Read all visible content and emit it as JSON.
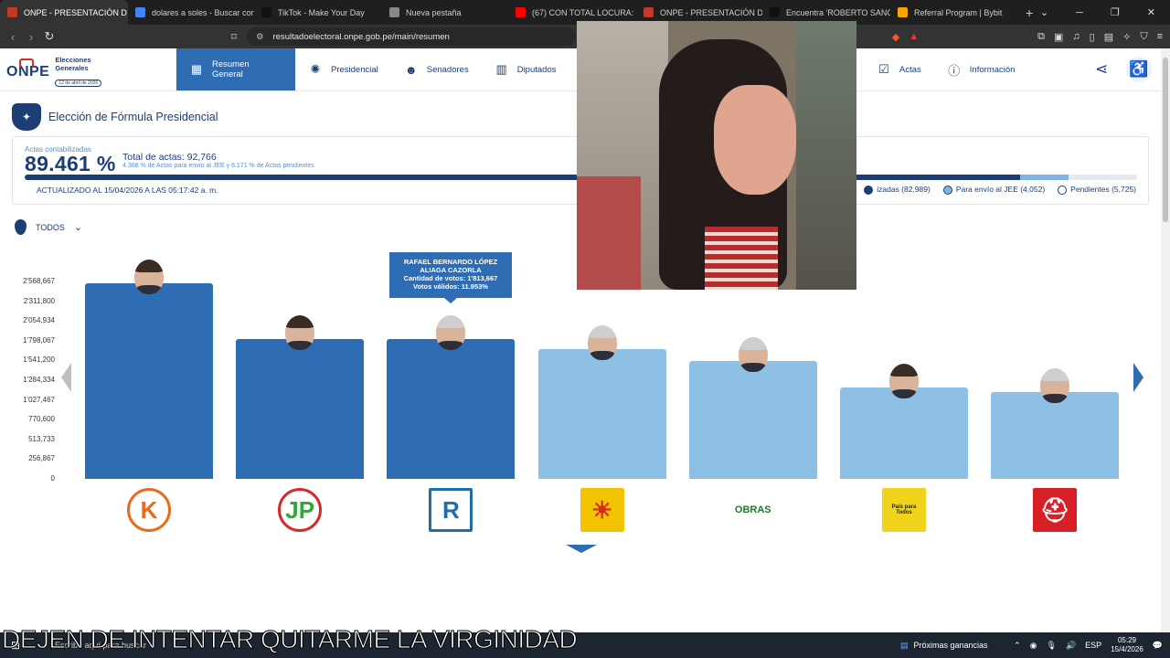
{
  "browser": {
    "tabs": [
      {
        "label": "ONPE - PRESENTACIÓN D",
        "color": "#c0392b",
        "active": true
      },
      {
        "label": "dolares a soles - Buscar con G",
        "color": "#4285f4",
        "active": false
      },
      {
        "label": "TikTok - Make Your Day",
        "color": "#111111",
        "active": false
      },
      {
        "label": "Nueva pestaña",
        "color": "#888888",
        "active": false
      },
      {
        "label": "(67) CON TOTAL LOCURA: LÓ",
        "color": "#ff0000",
        "active": false
      },
      {
        "label": "ONPE - PRESENTACIÓN DE R",
        "color": "#c0392b",
        "active": false
      },
      {
        "label": "Encuentra 'ROBERTO SANCHE",
        "color": "#111111",
        "active": false
      },
      {
        "label": "Referral Program | Bybit",
        "color": "#f7a600",
        "active": false
      }
    ],
    "url": "resultadoelectoral.onpe.gob.pe/main/resumen"
  },
  "header": {
    "logo_text": "ONPE",
    "logo_sub1": "Elecciones",
    "logo_sub2": "Generales",
    "logo_date": "12 de abril de 2026",
    "nav": [
      {
        "label": "Resumen General",
        "icon": "grid-icon",
        "active": true
      },
      {
        "label": "Presidencial",
        "icon": "seal-icon",
        "active": false
      },
      {
        "label": "Senadores",
        "icon": "people-icon",
        "active": false
      },
      {
        "label": "Diputados",
        "icon": "building-icon",
        "active": false
      }
    ],
    "nav_right": [
      {
        "label": "Actas",
        "icon": "check-icon"
      },
      {
        "label": "Información",
        "icon": "info-icon"
      }
    ]
  },
  "section": {
    "title": "Elección de Fórmula Presidencial"
  },
  "stats": {
    "label": "Actas contabilizadas",
    "percent": "89.461 %",
    "total": "Total de actas: 92,766",
    "sub": "4.368 % de Actas para envío al JEE y 6.171 % de Actas pendientes",
    "updated": "ACTUALIZADO AL 15/04/2026 A LAS 05:17:42 a. m.",
    "progress_counted": 89.461,
    "progress_jee": 4.368,
    "legend": [
      {
        "label": "izadas (82,989)",
        "color": "#1c3e75"
      },
      {
        "label": "Para envío al JEE (4,052)",
        "color": "#7fb3e3"
      },
      {
        "label": "Pendientes (5,725)",
        "color": "#ffffff"
      }
    ]
  },
  "filter": {
    "label": "TODOS"
  },
  "tooltip": {
    "name1": "RAFAEL BERNARDO LÓPEZ",
    "name2": "ALIAGA CAZORLA",
    "votes": "Cantidad de votos: 1'813,667",
    "valid": "Votos válidos: 11.953%"
  },
  "chart_data": {
    "type": "bar",
    "yticks": [
      "2'568,667",
      "2'311,800",
      "2'054,934",
      "1'798,067",
      "1'541,200",
      "1'284,334",
      "1'027,467",
      "770,600",
      "513,733",
      "256,867",
      "0"
    ],
    "ylim": [
      0,
      2568667
    ],
    "series": [
      {
        "values": [
          2550000,
          1813667,
          1813667,
          1690000,
          1540000,
          1190000,
          1130000
        ]
      }
    ],
    "bar_colors": [
      "#2e6db4",
      "#2e6db4",
      "#2e6db4",
      "#8ec0e6",
      "#8ec0e6",
      "#8ec0e6",
      "#8ec0e6"
    ],
    "party_logos": [
      {
        "text": "K",
        "bg": "#ffffff",
        "fg": "#e86b1f",
        "ring": "#e86b1f"
      },
      {
        "text": "JP",
        "bg": "#ffffff",
        "fg": "#2ea836",
        "ring": "#d62a2a"
      },
      {
        "text": "R",
        "bg": "#ffffff",
        "fg": "#1f6ea8",
        "ring": "#1f6ea8"
      },
      {
        "text": "☀",
        "bg": "#f2c300",
        "fg": "#d42a1c",
        "ring": "#f2c300"
      },
      {
        "text": "OBRAS",
        "bg": "#ffffff",
        "fg": "#1f7a2a",
        "ring": "#ffffff"
      },
      {
        "text": "País para Todos",
        "bg": "#f0d31a",
        "fg": "#222222",
        "ring": "#f0d31a"
      },
      {
        "text": "⛑",
        "bg": "#d61f26",
        "fg": "#ffffff",
        "ring": "#d61f26"
      }
    ],
    "grey_hair": [
      false,
      false,
      true,
      true,
      true,
      false,
      true
    ]
  },
  "overlay": {
    "caption": "DEJEN DE INTENTAR QUITARME LA VIRGINIDAD"
  },
  "taskbar": {
    "search_placeholder": "Escribe aquí para buscar",
    "news": "Próximas ganancias",
    "lang": "ESP",
    "time": "05:29",
    "date": "15/4/2026"
  }
}
